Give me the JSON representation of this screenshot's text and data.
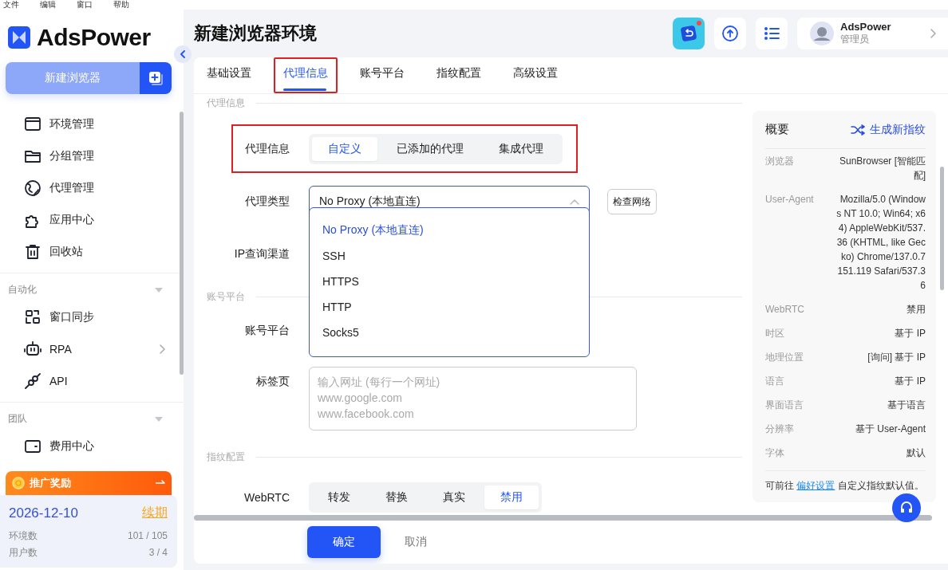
{
  "menu_bar": [
    "文件",
    "编辑",
    "窗口",
    "帮助"
  ],
  "logo": "AdsPower",
  "new_browser_button": "新建浏览器",
  "nav_sections": [
    {
      "items": [
        {
          "label": "环境管理",
          "kind": "window",
          "submenu": false
        },
        {
          "label": "分组管理",
          "kind": "folder",
          "submenu": false
        },
        {
          "label": "代理管理",
          "kind": "globe",
          "submenu": false
        },
        {
          "label": "应用中心",
          "kind": "puzzle",
          "submenu": false
        },
        {
          "label": "回收站",
          "kind": "trash",
          "submenu": false
        }
      ]
    },
    {
      "title": "自动化",
      "expanded": true,
      "items": [
        {
          "label": "窗口同步",
          "kind": "sync",
          "submenu": false
        },
        {
          "label": "RPA",
          "kind": "robot",
          "submenu": true
        },
        {
          "label": "API",
          "kind": "plug",
          "submenu": false
        }
      ]
    },
    {
      "title": "团队",
      "expanded": true,
      "items": [
        {
          "label": "费用中心",
          "kind": "wallet",
          "submenu": false
        }
      ]
    }
  ],
  "promo": "推广奖励",
  "plan": {
    "expiry": "2026-12-10",
    "renew": "续期",
    "stats": [
      {
        "label": "环境数",
        "value": "101 / 105"
      },
      {
        "label": "用户数",
        "value": "3 / 4"
      }
    ]
  },
  "page_title": "新建浏览器环境",
  "user": {
    "name": "AdsPower",
    "role": "管理员"
  },
  "tabs": [
    {
      "label": "基础设置",
      "selected": false,
      "highlighted": false
    },
    {
      "label": "代理信息",
      "selected": true,
      "highlighted": true
    },
    {
      "label": "账号平台",
      "selected": false,
      "highlighted": false
    },
    {
      "label": "指纹配置",
      "selected": false,
      "highlighted": false
    },
    {
      "label": "高级设置",
      "selected": false,
      "highlighted": false
    }
  ],
  "proxy": {
    "title": "代理信息",
    "highlighted": true,
    "source_label": "代理信息",
    "source_options": [
      {
        "label": "自定义",
        "selected": true
      },
      {
        "label": "已添加的代理",
        "selected": false
      },
      {
        "label": "集成代理",
        "selected": false
      }
    ],
    "type_label": "代理类型",
    "type_value": "No Proxy (本地直连)",
    "expanded": true,
    "type_options": [
      {
        "label": "No Proxy (本地直连)",
        "selected": true
      },
      {
        "label": "SSH",
        "selected": false
      },
      {
        "label": "HTTPS",
        "selected": false
      },
      {
        "label": "HTTP",
        "selected": false
      },
      {
        "label": "Socks5",
        "selected": false
      }
    ],
    "check_button": "检查网络",
    "ip_channel_label": "IP查询渠道"
  },
  "account": {
    "title": "账号平台",
    "platform_label": "账号平台",
    "tabs_label": "标签页",
    "tabs_placeholder": "输入网址 (每行一个网址)\nwww.google.com\nwww.facebook.com"
  },
  "fingerprint": {
    "title": "指纹配置",
    "webrtc_label": "WebRTC",
    "webrtc_options": [
      {
        "label": "转发",
        "selected": false
      },
      {
        "label": "替换",
        "selected": false
      },
      {
        "label": "真实",
        "selected": false
      },
      {
        "label": "禁用",
        "selected": true
      }
    ]
  },
  "footer": {
    "confirm": "确定",
    "cancel": "取消"
  },
  "summary": {
    "title": "概要",
    "regenerate": "生成新指纹",
    "rows": [
      {
        "label": "浏览器",
        "value": "SunBrowser [智能匹配]"
      },
      {
        "label": "User-Agent",
        "value": "Mozilla/5.0 (Windows NT 10.0; Win64; x64) AppleWebKit/537.36 (KHTML, like Gecko) Chrome/137.0.7151.119 Safari/537.36"
      },
      {
        "label": "WebRTC",
        "value": "禁用"
      },
      {
        "label": "时区",
        "value": "基于 IP"
      },
      {
        "label": "地理位置",
        "value": "[询问] 基于 IP"
      },
      {
        "label": "语言",
        "value": "基于 IP"
      },
      {
        "label": "界面语言",
        "value": "基于语言"
      },
      {
        "label": "分辨率",
        "value": "基于 User-Agent"
      },
      {
        "label": "字体",
        "value": "默认"
      }
    ],
    "note_prefix": "可前往",
    "note_link": "偏好设置",
    "note_suffix": "自定义指纹默认值。"
  }
}
